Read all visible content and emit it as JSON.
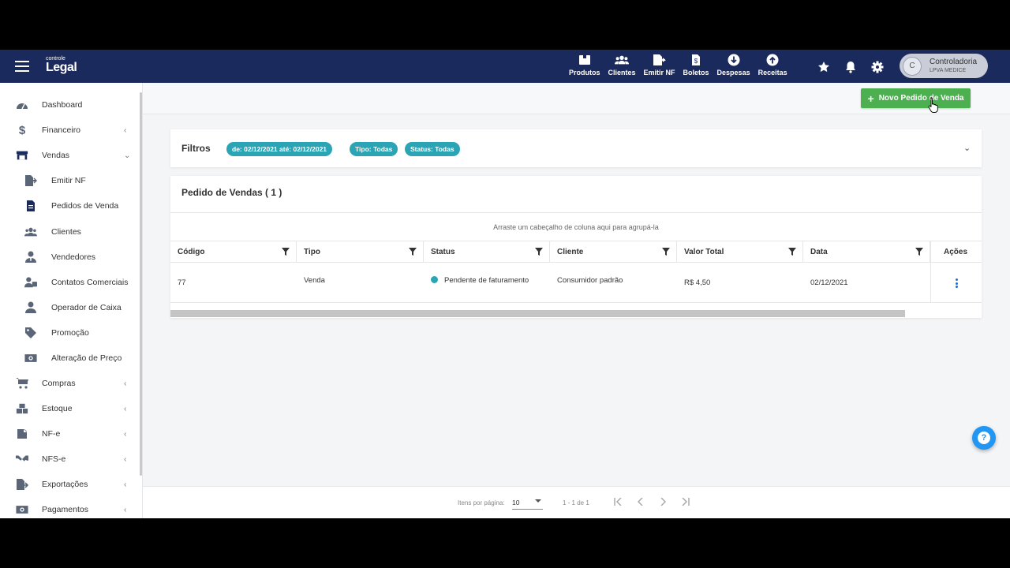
{
  "header": {
    "logo_small": "controle",
    "logo_big": "Legal",
    "nav": [
      {
        "label": "Produtos",
        "icon": "box-icon"
      },
      {
        "label": "Clientes",
        "icon": "users-icon"
      },
      {
        "label": "Emitir NF",
        "icon": "file-export-icon"
      },
      {
        "label": "Boletos",
        "icon": "invoice-icon"
      },
      {
        "label": "Despesas",
        "icon": "arrow-down-circle-icon"
      },
      {
        "label": "Receitas",
        "icon": "arrow-up-circle-icon"
      }
    ],
    "user": {
      "initial": "C",
      "name": "Controladoria",
      "company": "LPVA MEDICE"
    }
  },
  "sidebar": {
    "items": [
      {
        "label": "Dashboard",
        "icon": "gauge-icon",
        "sub": false,
        "chevron": ""
      },
      {
        "label": "Financeiro",
        "icon": "dollar-icon",
        "sub": false,
        "chevron": "‹"
      },
      {
        "label": "Vendas",
        "icon": "store-icon",
        "sub": false,
        "chevron": "⌄"
      },
      {
        "label": "Emitir NF",
        "icon": "file-export-icon",
        "sub": true,
        "chevron": ""
      },
      {
        "label": "Pedidos de Venda",
        "icon": "document-icon",
        "sub": true,
        "chevron": ""
      },
      {
        "label": "Clientes",
        "icon": "users-icon",
        "sub": true,
        "chevron": ""
      },
      {
        "label": "Vendedores",
        "icon": "user-tie-icon",
        "sub": true,
        "chevron": ""
      },
      {
        "label": "Contatos Comerciais",
        "icon": "user-contact-icon",
        "sub": true,
        "chevron": ""
      },
      {
        "label": "Operador de Caixa",
        "icon": "user-icon",
        "sub": true,
        "chevron": ""
      },
      {
        "label": "Promoção",
        "icon": "tag-icon",
        "sub": true,
        "chevron": ""
      },
      {
        "label": "Alteração de Preço",
        "icon": "money-icon",
        "sub": true,
        "chevron": ""
      },
      {
        "label": "Compras",
        "icon": "cart-icon",
        "sub": false,
        "chevron": "‹"
      },
      {
        "label": "Estoque",
        "icon": "boxes-icon",
        "sub": false,
        "chevron": "‹"
      },
      {
        "label": "NF-e",
        "icon": "nfe-icon",
        "sub": false,
        "chevron": "‹"
      },
      {
        "label": "NFS-e",
        "icon": "handshake-icon",
        "sub": false,
        "chevron": "‹"
      },
      {
        "label": "Exportações",
        "icon": "export-icon",
        "sub": false,
        "chevron": "‹"
      },
      {
        "label": "Pagamentos",
        "icon": "money-icon",
        "sub": false,
        "chevron": "‹"
      }
    ]
  },
  "actions": {
    "new_order": "Novo Pedido de Venda"
  },
  "filters": {
    "title": "Filtros",
    "chips": [
      "de: 02/12/2021 até: 02/12/2021",
      "Tipo: Todas",
      "Status: Todas"
    ]
  },
  "grid": {
    "title": "Pedido de Vendas ( 1 )",
    "group_hint": "Arraste um cabeçalho de coluna aqui para agrupá-la",
    "columns": [
      "Código",
      "Tipo",
      "Status",
      "Cliente",
      "Valor Total",
      "Data",
      "Ações"
    ],
    "rows": [
      {
        "codigo": "77",
        "tipo": "Venda",
        "status": "Pendente de faturamento",
        "cliente": "Consumidor padrão",
        "valor": "R$  4,50",
        "data": "02/12/2021"
      }
    ],
    "status_color": "#2ba5b6"
  },
  "pager": {
    "items_label": "Itens por página:",
    "page_size": "10",
    "range": "1 - 1 de 1"
  },
  "colors": {
    "topbar": "#1b2a5c",
    "primary_button": "#4caf50",
    "chip": "#2ba5b6",
    "help": "#2196f3"
  }
}
